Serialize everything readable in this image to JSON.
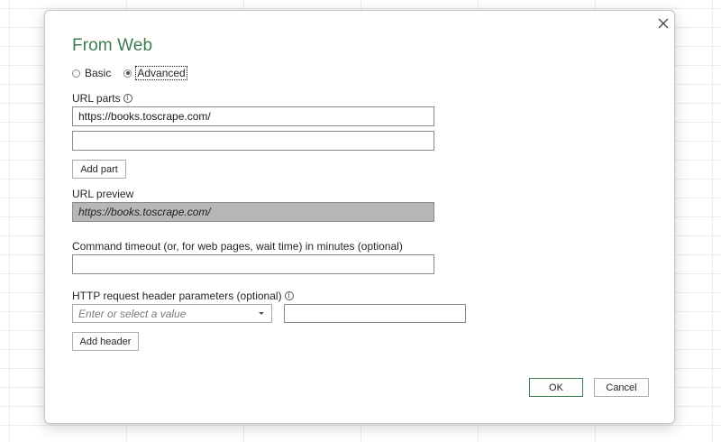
{
  "dialog": {
    "title": "From Web",
    "close_icon": "close-icon"
  },
  "mode": {
    "basic_label": "Basic",
    "advanced_label": "Advanced",
    "selected": "Advanced"
  },
  "url_parts": {
    "label": "URL parts",
    "info_icon": "info-icon",
    "parts": [
      {
        "value": "https://books.toscrape.com/"
      },
      {
        "value": ""
      }
    ],
    "add_part_label": "Add part"
  },
  "url_preview": {
    "label": "URL preview",
    "value": "https://books.toscrape.com/"
  },
  "timeout": {
    "label": "Command timeout (or, for web pages, wait time) in minutes (optional)",
    "value": ""
  },
  "http_headers": {
    "label": "HTTP request header parameters (optional)",
    "info_icon": "info-icon",
    "name_placeholder": "Enter or select a value",
    "value": "",
    "add_header_label": "Add header"
  },
  "footer": {
    "ok_label": "OK",
    "cancel_label": "Cancel"
  },
  "colors": {
    "title_green": "#3f7c52",
    "preview_bg": "#b7b7b7"
  }
}
